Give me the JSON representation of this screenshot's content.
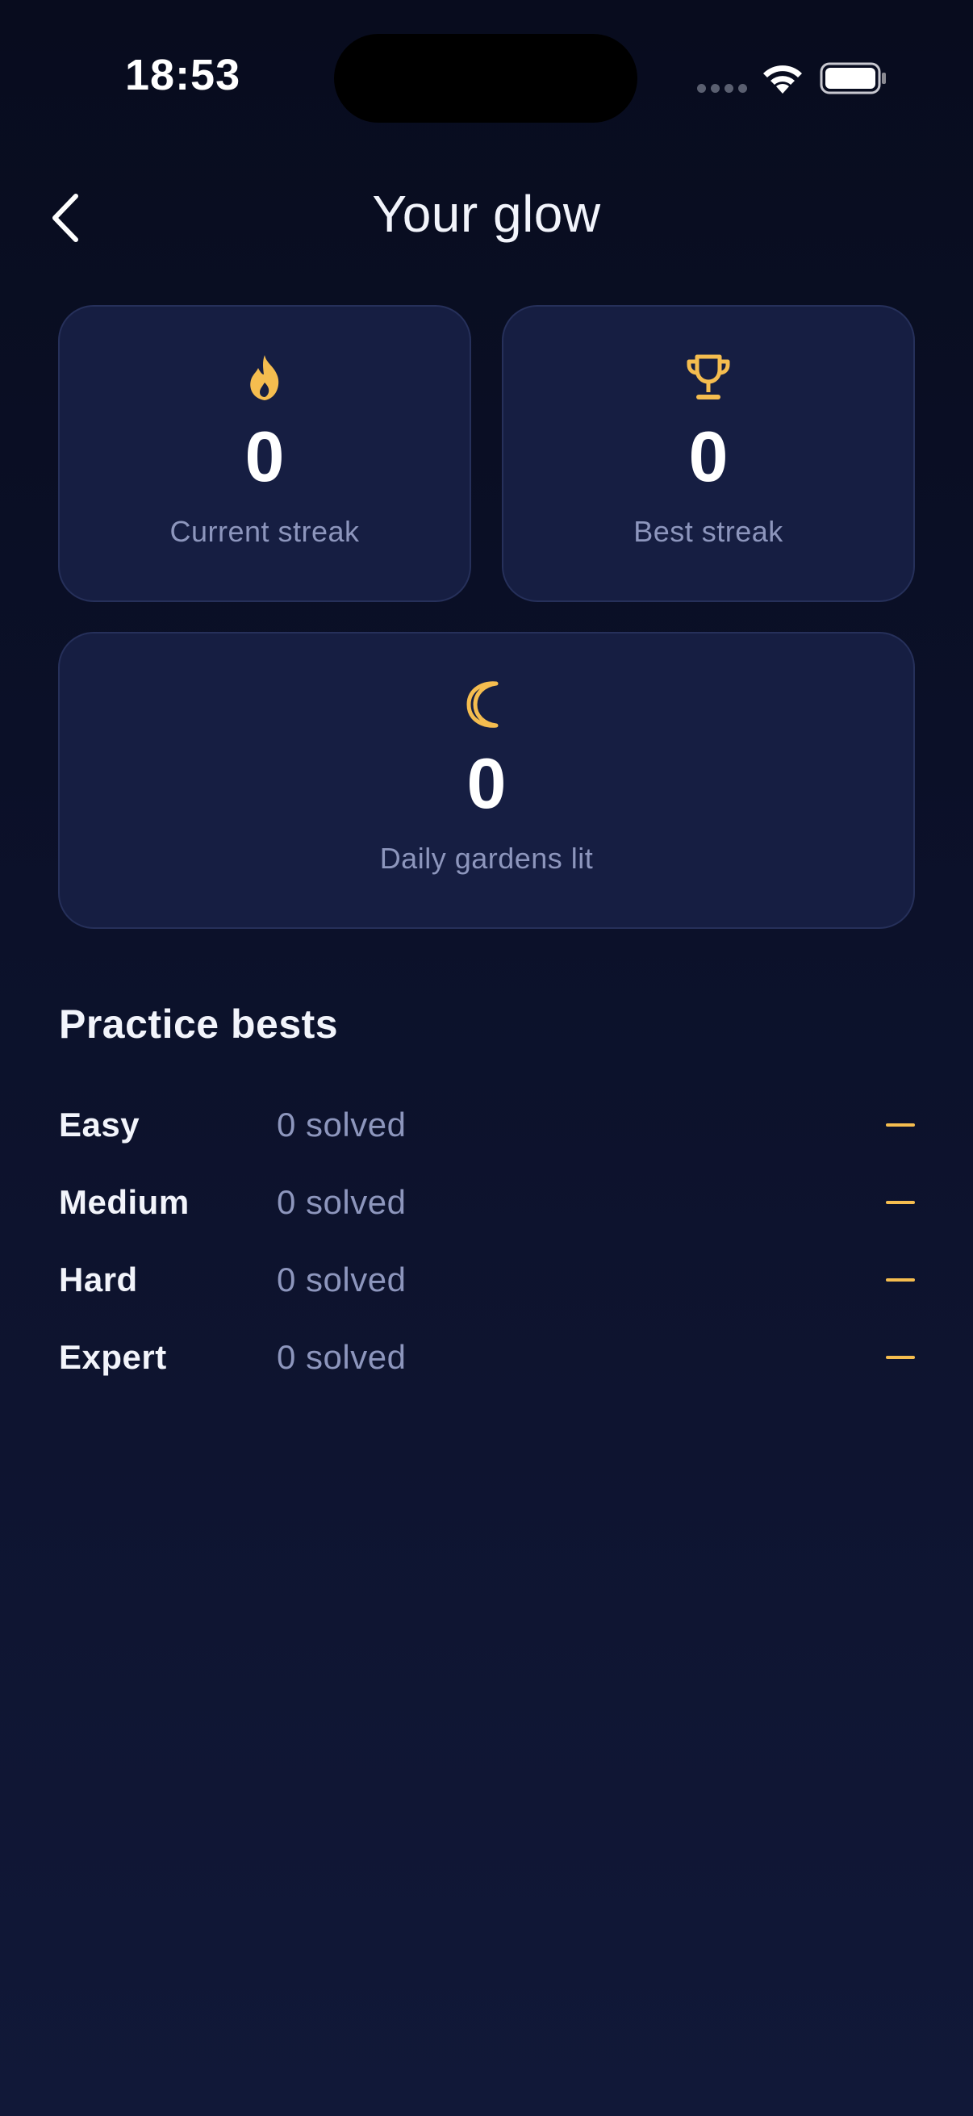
{
  "status_bar": {
    "time": "18:53"
  },
  "header": {
    "title": "Your glow",
    "back_icon": "chevron-left-icon"
  },
  "colors": {
    "background": "#0b1028",
    "card": "#161e42",
    "accent": "#f5bd4f",
    "muted_text": "#8d96bd"
  },
  "stats": {
    "current_streak": {
      "icon": "flame-icon",
      "value": "0",
      "label": "Current streak"
    },
    "best_streak": {
      "icon": "trophy-icon",
      "value": "0",
      "label": "Best streak"
    },
    "daily_gardens": {
      "icon": "moon-icon",
      "value": "0",
      "label": "Daily gardens lit"
    }
  },
  "practice": {
    "title": "Practice bests",
    "rows": [
      {
        "level": "Easy",
        "solved": "0 solved",
        "best": "—"
      },
      {
        "level": "Medium",
        "solved": "0 solved",
        "best": "—"
      },
      {
        "level": "Hard",
        "solved": "0 solved",
        "best": "—"
      },
      {
        "level": "Expert",
        "solved": "0 solved",
        "best": "—"
      }
    ]
  }
}
